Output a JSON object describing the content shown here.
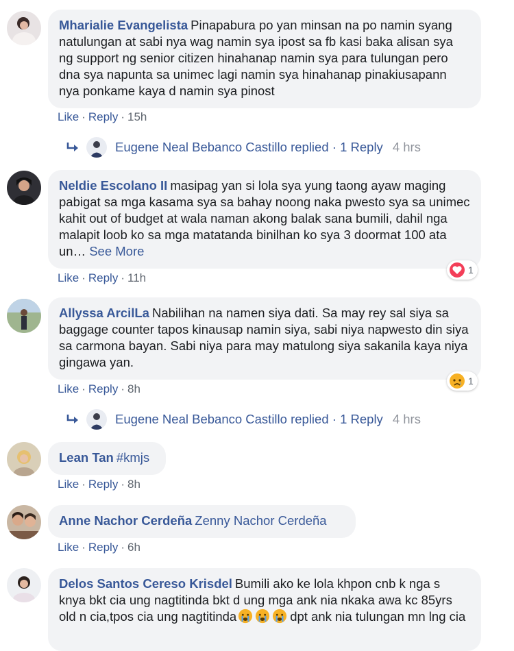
{
  "comments": [
    {
      "author": "Mharialie Evangelista",
      "text": "Pinapabura po yan minsan na po namin syang natulungan at sabi nya wag namin sya ipost sa fb kasi baka alisan sya ng support ng senior citizen hinahanap namin sya para tulungan pero dna sya napunta sa unimec lagi namin sya hinahanap pinakiusapann nya ponkame kaya d namin sya pinost",
      "like": "Like",
      "reply": "Reply",
      "time": "15h",
      "replies": {
        "name": "Eugene Neal Bebanco Castillo replied",
        "count": "1 Reply",
        "time": "4 hrs"
      }
    },
    {
      "author": "Neldie Escolano II",
      "text": "masipag yan si lola sya yung taong ayaw maging pabigat sa mga kasama sya sa bahay noong naka pwesto sya sa unimec kahit out of budget at wala naman akong balak sana bumili, dahil nga malapit loob ko sa mga matatanda binilhan ko sya 3 doormat 100 ata un…",
      "see_more": "See More",
      "like": "Like",
      "reply": "Reply",
      "time": "11h",
      "reaction": {
        "icon": "heart-icon",
        "count": "1"
      }
    },
    {
      "author": "Allyssa ArcilLa",
      "text": "Nabilihan na namen siya dati. Sa may rey sal siya sa baggage counter tapos kinausap namin siya, sabi niya napwesto din siya sa carmona bayan. Sabi niya para may matulong siya sakanila kaya niya gingawa yan.",
      "like": "Like",
      "reply": "Reply",
      "time": "8h",
      "reaction": {
        "icon": "sad-icon",
        "count": "1"
      },
      "replies": {
        "name": "Eugene Neal Bebanco Castillo replied",
        "count": "1 Reply",
        "time": "4 hrs"
      }
    },
    {
      "author": "Lean Tan",
      "text": "#kmjs",
      "like": "Like",
      "reply": "Reply",
      "time": "8h"
    },
    {
      "author": "Anne Nachor Cerdeña",
      "text": "Zenny Nachor Cerdeña",
      "like": "Like",
      "reply": "Reply",
      "time": "6h"
    },
    {
      "author": "Delos Santos Cereso Krisdel",
      "text_part1": "Bumili ako ke lola khpon cnb k nga s knya bkt cia ung nagtitinda bkt d ung mga ank nia nkaka awa kc 85yrs old n cia,tpos cia ung nagtitinda",
      "text_part2": "dpt ank nia tulungan mn lng cia"
    }
  ],
  "separator": "·",
  "colors": {
    "link": "#385898",
    "bubble": "#f2f3f5",
    "meta": "#606770",
    "heart": "#f33e58",
    "emoji": "#f7b125"
  }
}
